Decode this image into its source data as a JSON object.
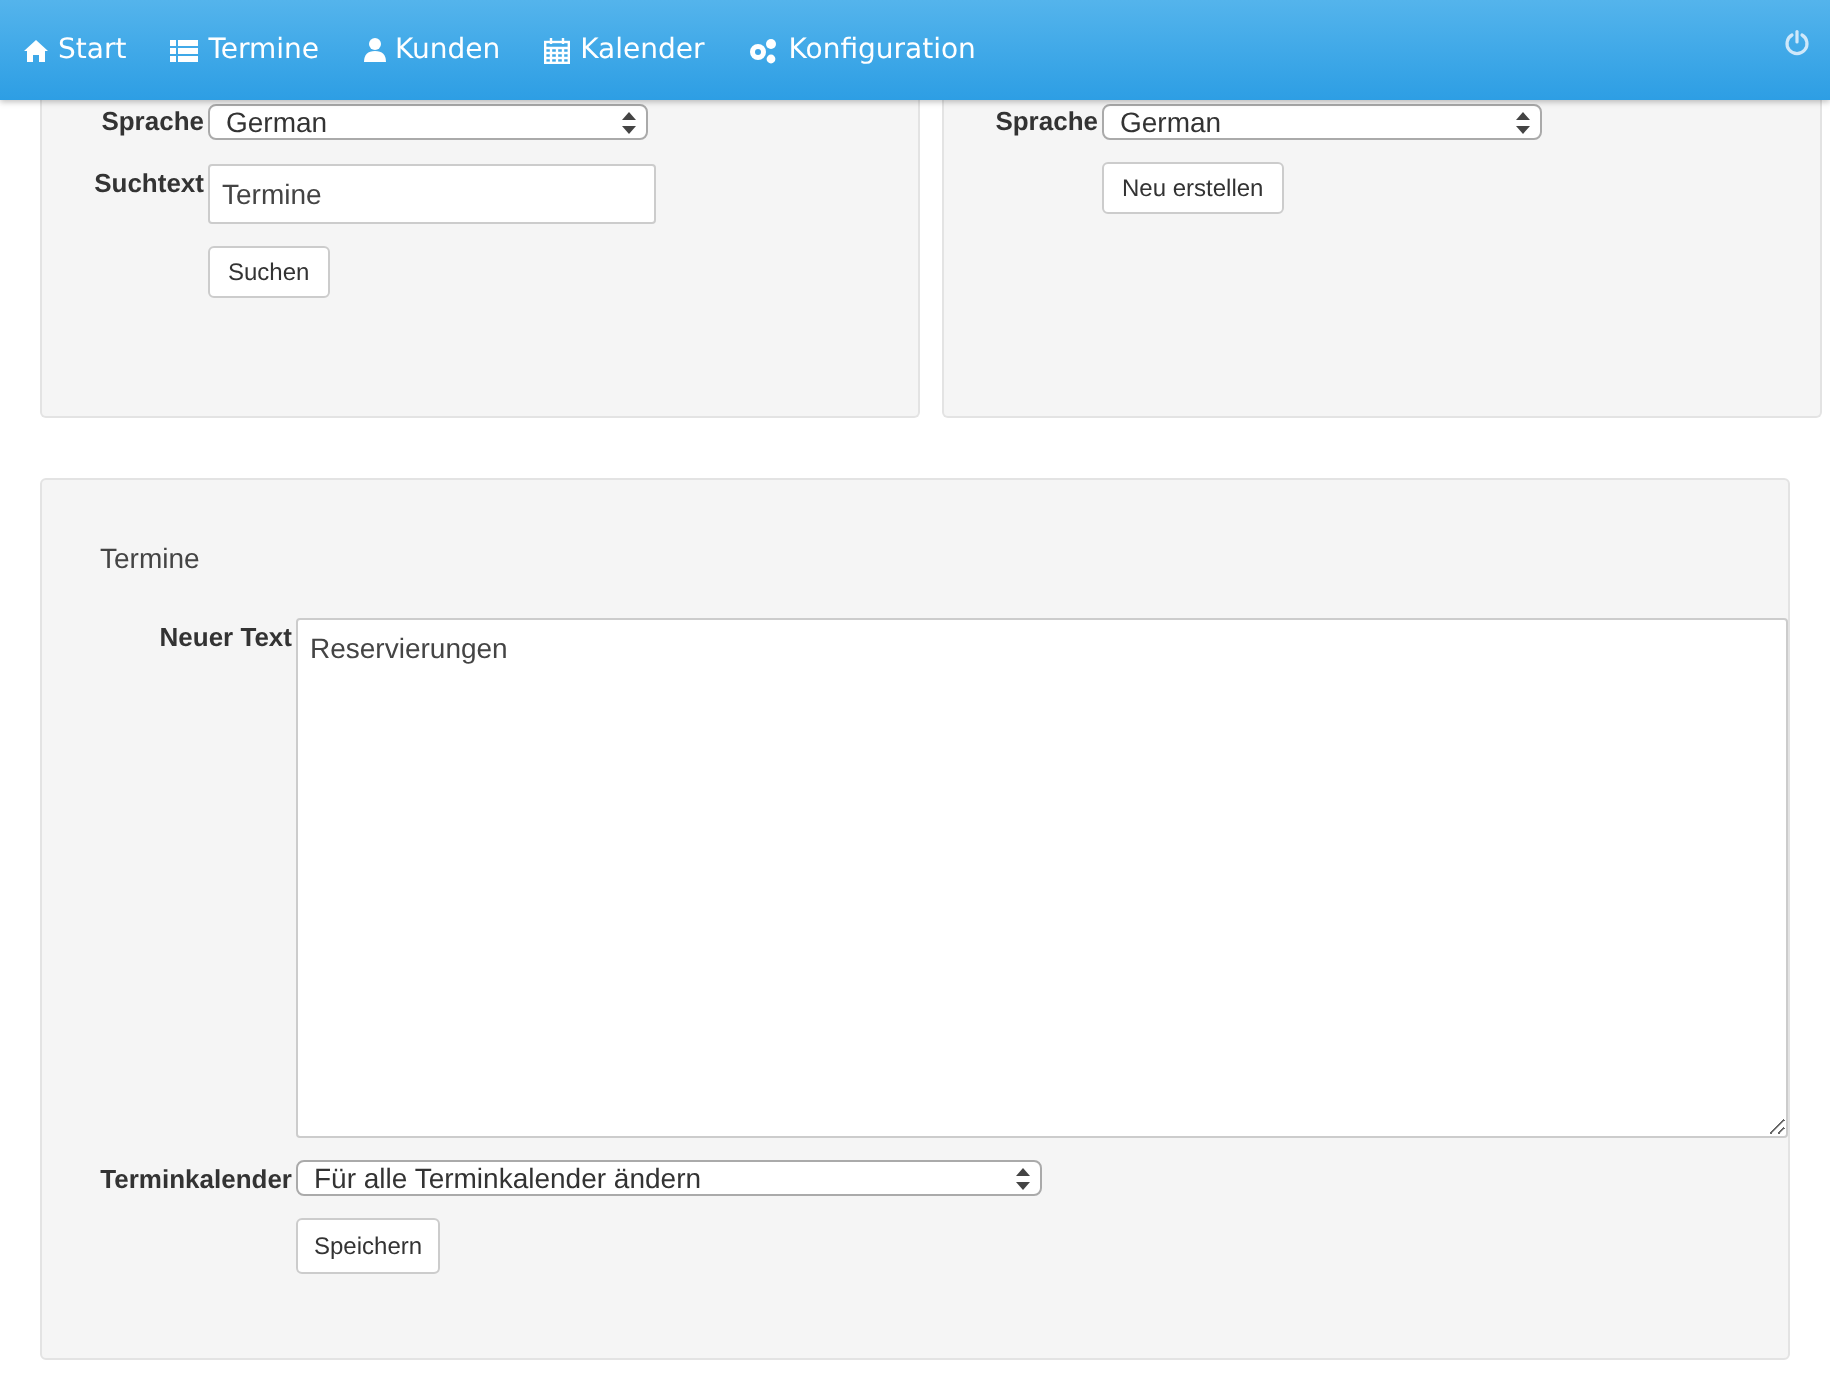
{
  "navbar": {
    "items": [
      {
        "label": "Start"
      },
      {
        "label": "Termine"
      },
      {
        "label": "Kunden"
      },
      {
        "label": "Kalender"
      },
      {
        "label": "Konfiguration"
      }
    ]
  },
  "search_panel": {
    "language_label": "Sprache",
    "language": "German",
    "search_label": "Suchtext",
    "search_value": "Termine",
    "button": "Suchen"
  },
  "create_panel": {
    "language_label": "Sprache",
    "language": "German",
    "button": "Neu erstellen"
  },
  "edit_panel": {
    "title": "Termine",
    "text_label": "Neuer Text",
    "text_value": "Reservierungen",
    "calendar_label": "Terminkalender",
    "calendar": "Für alle Terminkalender ändern",
    "button": "Speichern"
  }
}
